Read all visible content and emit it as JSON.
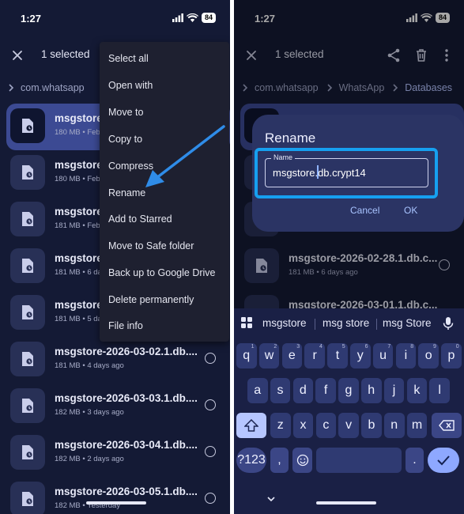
{
  "left": {
    "status": {
      "time": "1:27",
      "battery": "84"
    },
    "app_bar": {
      "selected_text": "1 selected"
    },
    "breadcrumb": [
      "com.whatsapp"
    ],
    "files": [
      {
        "name": "msgstore",
        "meta": "180 MB • Feb",
        "selected": true
      },
      {
        "name": "msgstore",
        "meta": "180 MB • Feb",
        "selected": false
      },
      {
        "name": "msgstore",
        "meta": "181 MB • Feb",
        "selected": false
      },
      {
        "name": "msgstore",
        "meta": "181 MB • 6 da",
        "selected": false
      },
      {
        "name": "msgstore",
        "meta": "181 MB • 5 da",
        "selected": false
      },
      {
        "name": "msgstore-2026-03-02.1.db....",
        "meta": "181 MB • 4 days ago",
        "selected": false
      },
      {
        "name": "msgstore-2026-03-03.1.db....",
        "meta": "182 MB • 3 days ago",
        "selected": false
      },
      {
        "name": "msgstore-2026-03-04.1.db....",
        "meta": "182 MB • 2 days ago",
        "selected": false
      },
      {
        "name": "msgstore-2026-03-05.1.db....",
        "meta": "182 MB • Yesterday",
        "selected": false
      }
    ],
    "menu": [
      "Select all",
      "Open with",
      "Move to",
      "Copy to",
      "Compress",
      "Rename",
      "Add to Starred",
      "Move to Safe folder",
      "Back up to Google Drive",
      "Delete permanently",
      "File info"
    ]
  },
  "right": {
    "status": {
      "time": "1:27",
      "battery": "84"
    },
    "app_bar": {
      "selected_text": "1 selected"
    },
    "breadcrumb": [
      "com.whatsapp",
      "WhatsApp",
      "Databases"
    ],
    "files": [
      {
        "name": "msgstore-2026-02-28.1.db.c...",
        "meta": "181 MB • 6 days ago"
      },
      {
        "name": "msgstore-2026-03-01.1.db.c...",
        "meta": ""
      }
    ],
    "dialog": {
      "title": "Rename",
      "field_label": "Name",
      "field_value_before": "msgstore",
      "field_value_after": ".db.crypt14",
      "cancel": "Cancel",
      "ok": "OK"
    },
    "keyboard": {
      "suggestions": [
        "msgstore",
        "msg store",
        "msg Store"
      ],
      "row1": [
        "q",
        "w",
        "e",
        "r",
        "t",
        "y",
        "u",
        "i",
        "o",
        "p"
      ],
      "row1_hints": [
        "1",
        "2",
        "3",
        "4",
        "5",
        "6",
        "7",
        "8",
        "9",
        "0"
      ],
      "row2": [
        "a",
        "s",
        "d",
        "f",
        "g",
        "h",
        "j",
        "k",
        "l"
      ],
      "row3": [
        "z",
        "x",
        "c",
        "v",
        "b",
        "n",
        "m"
      ],
      "symbols_key": "?123",
      "comma_key": ",",
      "period_key": "."
    }
  },
  "colors": {
    "background": "#141a35",
    "selected_row": "#3c4a93",
    "highlight": "#16a0f0",
    "arrow": "#2f8ce8"
  }
}
